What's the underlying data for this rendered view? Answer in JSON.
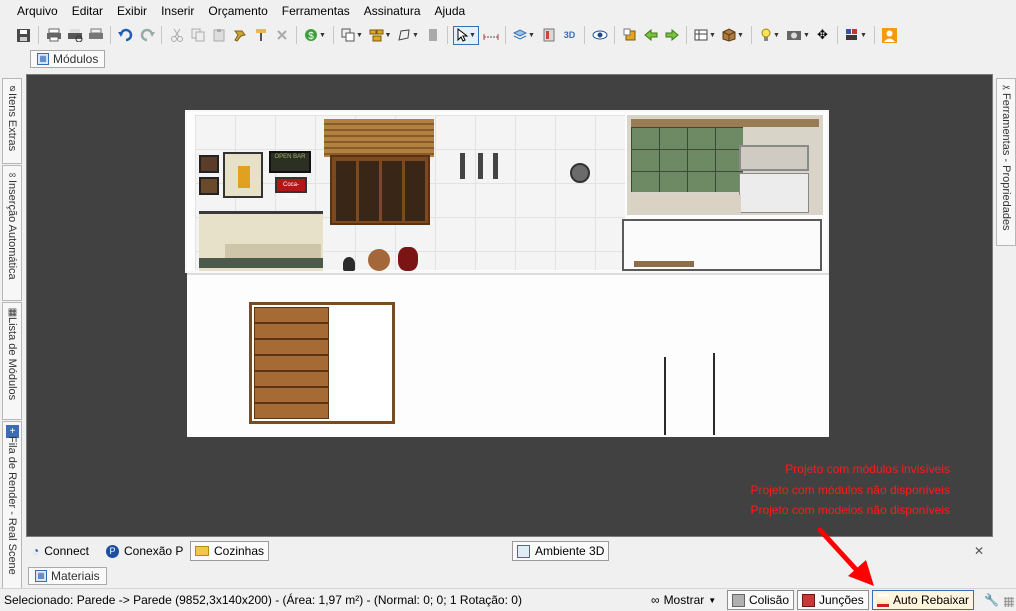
{
  "menu": [
    "Arquivo",
    "Editar",
    "Exibir",
    "Inserir",
    "Orçamento",
    "Ferramentas",
    "Assinatura",
    "Ajuda"
  ],
  "toolbar_icons": [
    "save-icon",
    "print-icon",
    "print-preview-icon",
    "print-setup-icon",
    "undo-icon",
    "redo-icon",
    "cut-icon",
    "copy-icon",
    "paste-icon",
    "format-painter-icon",
    "clear-format-icon",
    "delete-icon",
    "budget-icon",
    "layers-icon",
    "group-icon",
    "shape-icon",
    "door-icon",
    "select-icon",
    "measure-icon",
    "render-icon",
    "view-3d-icon",
    "eye-icon",
    "module-icon",
    "back-icon",
    "forward-icon",
    "camera-frame-icon",
    "box-icon",
    "light-icon",
    "camera-icon",
    "move-icon",
    "color-icon",
    "user-icon"
  ],
  "tabs": {
    "modulos": "Módulos",
    "materiais": "Materiais"
  },
  "left_side_tabs": [
    "Itens Extras",
    "Inserção Automática",
    "Lista de Módulos",
    "Fila de Render - Real Scene"
  ],
  "right_side_tabs": [
    "Ferramentas - Propriedades"
  ],
  "scene": {
    "sign_text": "OPEN BAR",
    "coke_sign": "Coca-Cola"
  },
  "notices": [
    "Projeto com módulos invisíveis",
    "Projeto com módulos não disponíveis",
    "Projeto com modelos não disponíveis"
  ],
  "bottom_tabs": {
    "connect": "Connect",
    "conexao": "Conexão P",
    "cozinhas": "Cozinhas",
    "ambiente": "Ambiente 3D",
    "close": "✕"
  },
  "status": {
    "selection": "Selecionado: Parede -> Parede (9852,3x140x200) - (Área: 1,97 m²) - (Normal: 0; 0; 1 Rotação: 0)",
    "mostrar": "Mostrar",
    "colisao": "Colisão",
    "juncoes": "Junções",
    "auto_rebaixar": "Auto Rebaixar"
  },
  "colors": {
    "viewport_bg": "#414141",
    "notice_red": "#ff1a1a",
    "wood": "#8a5a2b",
    "arrow_red": "#ff0000"
  }
}
